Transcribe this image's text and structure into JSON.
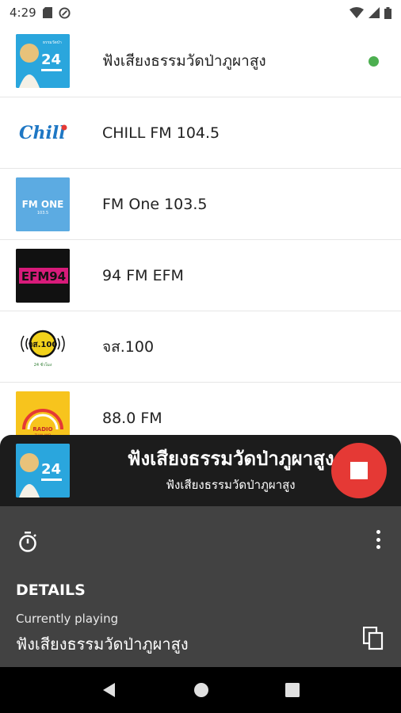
{
  "status_bar": {
    "time": "4:29"
  },
  "stations": [
    {
      "name": "ฟังเสียงธรรมวัดป่าภูผาสูง",
      "logo": "dhamma-24-logo",
      "playing": true
    },
    {
      "name": "CHILL FM 104.5",
      "logo": "chill-logo"
    },
    {
      "name": "FM One 103.5",
      "logo": "fm-one-logo",
      "logo_text": "FM ONE"
    },
    {
      "name": "94 FM EFM",
      "logo": "efm94-logo",
      "logo_text": "EFM94"
    },
    {
      "name": "จส.100",
      "logo": "js100-logo",
      "logo_text": "จส.100"
    },
    {
      "name": "88.0 FM",
      "logo": "radio-thailand-logo",
      "logo_text": "RADIO THAILAND"
    }
  ],
  "player": {
    "title": "ฟังเสียงธรรมวัดป่าภูผาสูง",
    "subtitle": "ฟังเสียงธรรมวัดป่าภูผาสูง",
    "logo_text": "24"
  },
  "details": {
    "heading": "DETAILS",
    "currently_playing_label": "Currently playing",
    "currently_playing_value": "ฟังเสียงธรรมวัดป่าภูผาสูง"
  },
  "colors": {
    "accent_red": "#e53935",
    "playing_dot": "#4caf50",
    "player_bg": "#1c1c1c",
    "details_bg": "#424242"
  }
}
